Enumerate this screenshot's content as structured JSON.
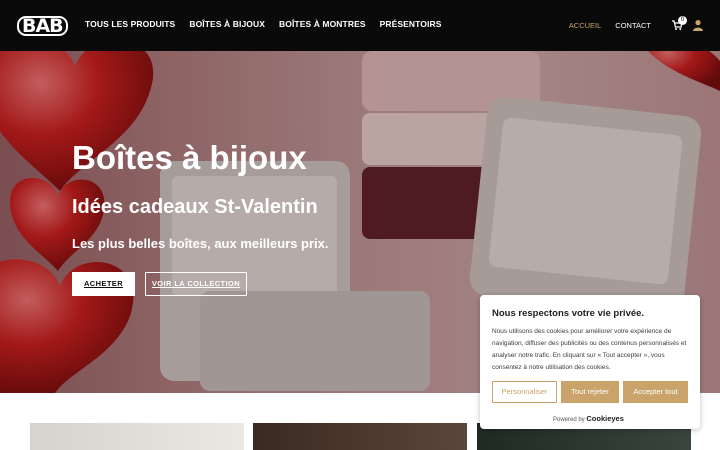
{
  "header": {
    "logo": "BAB",
    "nav": [
      "TOUS LES PRODUITS",
      "BOÎTES À BIJOUX",
      "BOÎTES À MONTRES",
      "PRÉSENTOIRS"
    ],
    "right_nav": {
      "home": "ACCUEIL",
      "contact": "CONTACT"
    },
    "cart_count": "0",
    "icons": [
      "cart-icon",
      "user-icon"
    ]
  },
  "hero": {
    "title": "Boîtes à bijoux",
    "subtitle": "Idées cadeaux St-Valentin",
    "tagline": "Les plus belles boîtes, aux meilleurs prix.",
    "buy_label": "ACHETER",
    "collection_label": "VOIR LA COLLECTION"
  },
  "cookie": {
    "title": "Nous respectons votre vie privée.",
    "text": "Nous utilisons des cookies pour améliorer votre expérience de navigation, diffuser des publicités ou des contenus personnalisés et analyser notre trafic. En cliquant sur « Tout accepter », vous consentez à notre utilisation des cookies.",
    "customize": "Personnaliser",
    "reject": "Tout rejeter",
    "accept": "Accepter tout",
    "powered_by": "Powered by",
    "brand": "Cookieyes"
  },
  "colors": {
    "accent": "#c9a36a",
    "header_bg": "#0a0a0a"
  }
}
